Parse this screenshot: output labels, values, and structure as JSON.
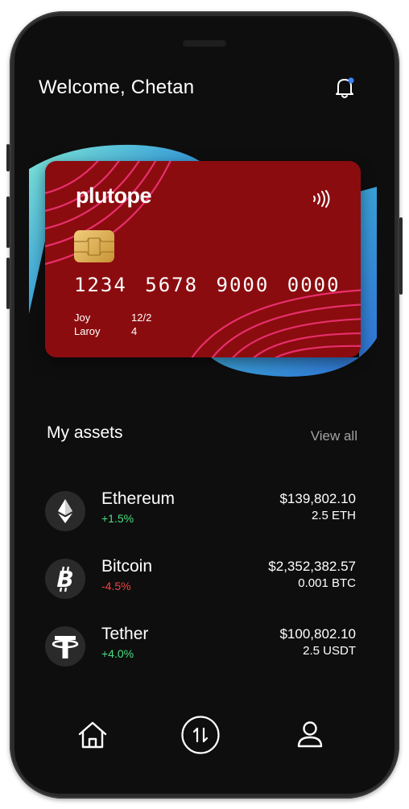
{
  "header": {
    "welcome": "Welcome, Chetan",
    "bell_icon": "bell-icon",
    "notification_dot_color": "#3b82f6"
  },
  "card": {
    "brand": "plutope",
    "number": "1234 5678 9000 0000",
    "holder_line1": "Joy",
    "holder_line2": "Laroy",
    "expiry_line1": "12/2",
    "expiry_line2": "4",
    "background_color": "#8b0c0f",
    "accent_line_color": "#e82f6c",
    "contactless_icon": "contactless-icon",
    "chip_icon": "chip-icon"
  },
  "assets": {
    "title": "My assets",
    "view_all": "View all",
    "items": [
      {
        "name": "Ethereum",
        "change": "+1.5%",
        "change_color": "#4ade80",
        "value": "$139,802.10",
        "quantity": "2.5 ETH",
        "icon": "ethereum-icon"
      },
      {
        "name": "Bitcoin",
        "change": "-4.5%",
        "change_color": "#ef4444",
        "value": "$2,352,382.57",
        "quantity": "0.001 BTC",
        "icon": "bitcoin-icon"
      },
      {
        "name": "Tether",
        "change": "+4.0%",
        "change_color": "#4ade80",
        "value": "$100,802.10",
        "quantity": "2.5 USDT",
        "icon": "tether-icon"
      }
    ]
  },
  "nav": {
    "items": [
      {
        "icon": "home-icon"
      },
      {
        "icon": "swap-icon"
      },
      {
        "icon": "profile-icon"
      }
    ]
  }
}
